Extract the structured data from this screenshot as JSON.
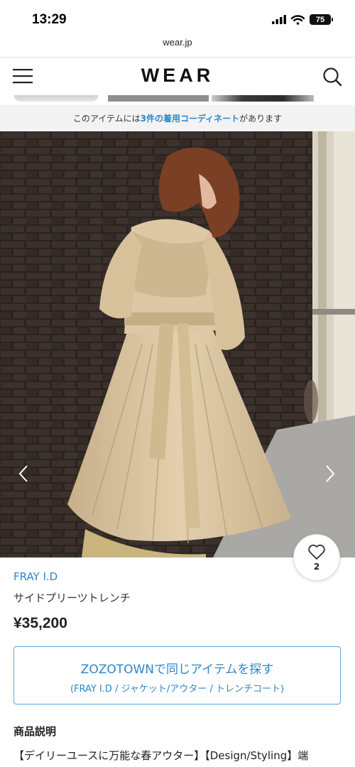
{
  "status_bar": {
    "time": "13:29",
    "battery": "75",
    "signal_icon": "cellular-signal-icon",
    "wifi_icon": "wifi-icon"
  },
  "browser": {
    "url": "wear.jp"
  },
  "header": {
    "logo": "WEAR",
    "menu_icon": "hamburger-menu-icon",
    "search_icon": "search-icon"
  },
  "coordinate_banner": {
    "prefix": "このアイテムには",
    "highlight": "3件の着用コーディネート",
    "suffix": "があります"
  },
  "gallery": {
    "prev_icon": "chevron-left-icon",
    "next_icon": "chevron-right-icon"
  },
  "like": {
    "icon": "heart-icon",
    "count": "2"
  },
  "item": {
    "brand": "FRAY I.D",
    "name": "サイドプリーツトレンチ",
    "price": "¥35,200"
  },
  "zozotown_button": {
    "label": "ZOZOTOWNで同じアイテムを探す",
    "sub_label": "(FRAY I.D / ジャケット/アウター / トレンチコート)"
  },
  "description": {
    "heading": "商品説明",
    "text": "【デイリーユースに万能な春アウター】【Design/Styling】端"
  },
  "colors": {
    "accent": "#2f86c7",
    "banner_bg": "#f3f3f3",
    "coat": "#d8c3a0"
  }
}
